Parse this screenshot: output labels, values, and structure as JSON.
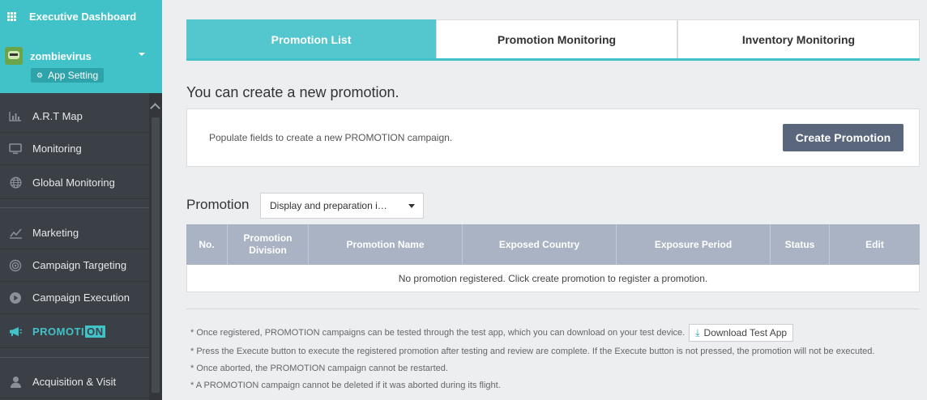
{
  "sidebar": {
    "dashboard_label": "Executive Dashboard",
    "user_name": "zombievirus",
    "app_setting_label": "App Setting",
    "items": [
      {
        "label": "A.R.T Map",
        "icon": "bar-chart-icon"
      },
      {
        "label": "Monitoring",
        "icon": "monitor-icon"
      },
      {
        "label": "Global Monitoring",
        "icon": "globe-icon"
      },
      {
        "label": "Marketing",
        "icon": "line-chart-icon"
      },
      {
        "label": "Campaign Targeting",
        "icon": "target-icon"
      },
      {
        "label": "Campaign Execution",
        "icon": "play-icon"
      },
      {
        "label_main": "PROMOTI",
        "label_badge": "ON",
        "icon": "megaphone-icon"
      },
      {
        "label": "Acquisition & Visit",
        "icon": "person-icon"
      }
    ]
  },
  "tabs": [
    {
      "label": "Promotion List",
      "active": true
    },
    {
      "label": "Promotion Monitoring",
      "active": false
    },
    {
      "label": "Inventory Monitoring",
      "active": false
    }
  ],
  "create": {
    "headline": "You can create a new promotion.",
    "description": "Populate fields to create a new PROMOTION campaign.",
    "button_label": "Create Promotion"
  },
  "promotion": {
    "title": "Promotion",
    "filter_value": "Display and preparation i…"
  },
  "table": {
    "columns": [
      "No.",
      "Promotion Division",
      "Promotion Name",
      "Exposed Country",
      "Exposure Period",
      "Status",
      "Edit"
    ],
    "empty_message": "No promotion registered. Click create promotion to register a promotion."
  },
  "notes": {
    "line1": "* Once registered, PROMOTION campaigns can be tested through the test app, which you can download on your test device.",
    "download_label": "Download Test App",
    "line2": "* Press the Execute button to execute the registered promotion after testing and review are complete. If the Execute button is not pressed, the promotion will not be executed.",
    "line3": "* Once aborted, the PROMOTION campaign cannot be restarted.",
    "line4": "* A PROMOTION campaign cannot be deleted if it was aborted during its flight."
  },
  "colors": {
    "accent": "#41c2c9",
    "sidebar_bg": "#3b4046",
    "button_dark": "#59667c",
    "table_header": "#aab3c4"
  }
}
